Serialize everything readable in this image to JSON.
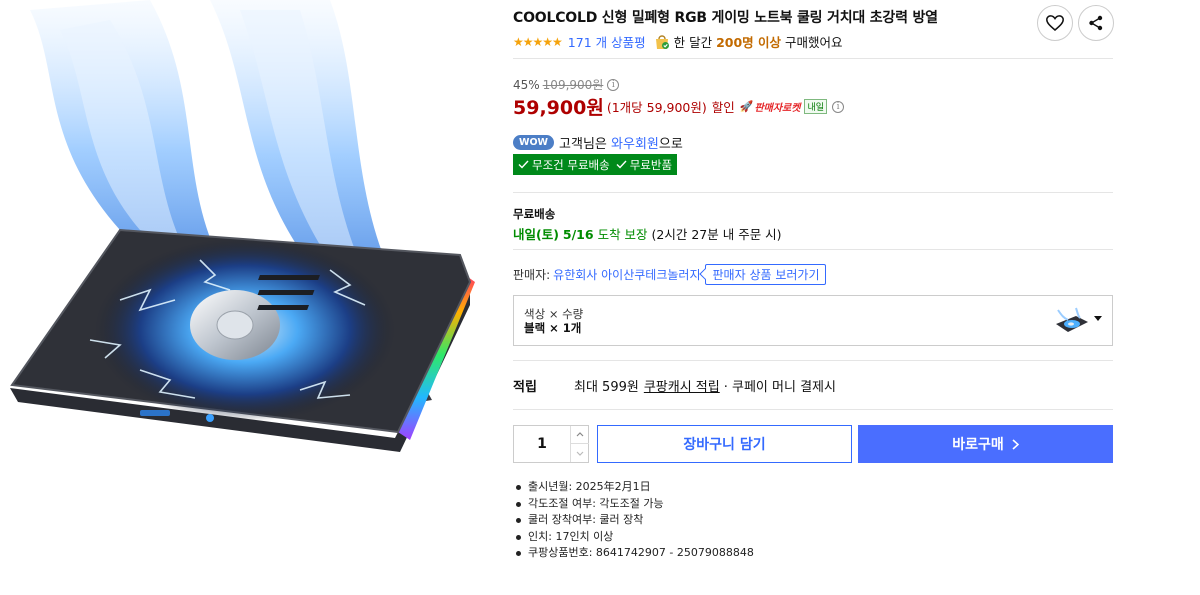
{
  "product": {
    "title": "COOLCOLD 신형 밀폐형 RGB 게이밍 노트북 쿨링 거치대 초강력 방열",
    "rating_stars": "★★★★★",
    "review_count": "171 개 상품평",
    "bought_prefix": "한 달간",
    "bought_count": "200명 이상",
    "bought_suffix": "구매했어요"
  },
  "icons": {
    "wishlist": "heart-icon",
    "share": "share-icon",
    "bag": "shopping-bag-icon",
    "info": "info-icon",
    "rocket": "rocket-icon",
    "check": "check-icon",
    "caret": "caret-down-icon",
    "chevron": "chevron-right-icon"
  },
  "price": {
    "discount_rate": "45%",
    "original_price": "109,900원",
    "sale_price": "59,900원",
    "unit_price": "(1개당 59,900원)",
    "discount_word": "할인",
    "rocket_label": "판매자로켓",
    "tomorrow_badge": "내일"
  },
  "wow": {
    "badge": "WOW",
    "text_prefix": "고객님은",
    "link": "와우회원",
    "text_suffix": "으로",
    "benefit_1": "무조건 무료배송",
    "benefit_2": "무료반품"
  },
  "shipping": {
    "label": "무료배송",
    "arrival_day": "내일(토)",
    "arrival_date": "5/16",
    "guarantee": "도착 보장",
    "condition": "(2시간 27분 내 주문 시)"
  },
  "seller": {
    "label": "판매자:",
    "name": "유한회사 아이산쿠테크놀러지",
    "button": "판매자 상품 보러가기"
  },
  "option": {
    "label": "색상 × 수량",
    "value": "블랙 × 1개"
  },
  "reward": {
    "label": "적립",
    "text": "최대 599원",
    "link": "쿠팡캐시 적립",
    "suffix": "· 쿠페이 머니 결제시"
  },
  "purchase": {
    "quantity": "1",
    "cart_button": "장바구니 담기",
    "buy_button": "바로구매"
  },
  "specs": [
    "출시년월: 2025年2月1日",
    "각도조절 여부: 각도조절 가능",
    "쿨러 장착여부: 쿨러 장착",
    "인치: 17인치 이상",
    "쿠팡상품번호: 8641742907 - 25079088848"
  ],
  "colors": {
    "accent_blue": "#346aff",
    "buy_blue": "#4a6eff",
    "price_red": "#ae0000",
    "benefit_green": "#00891a",
    "star_orange": "#f5a30c"
  }
}
